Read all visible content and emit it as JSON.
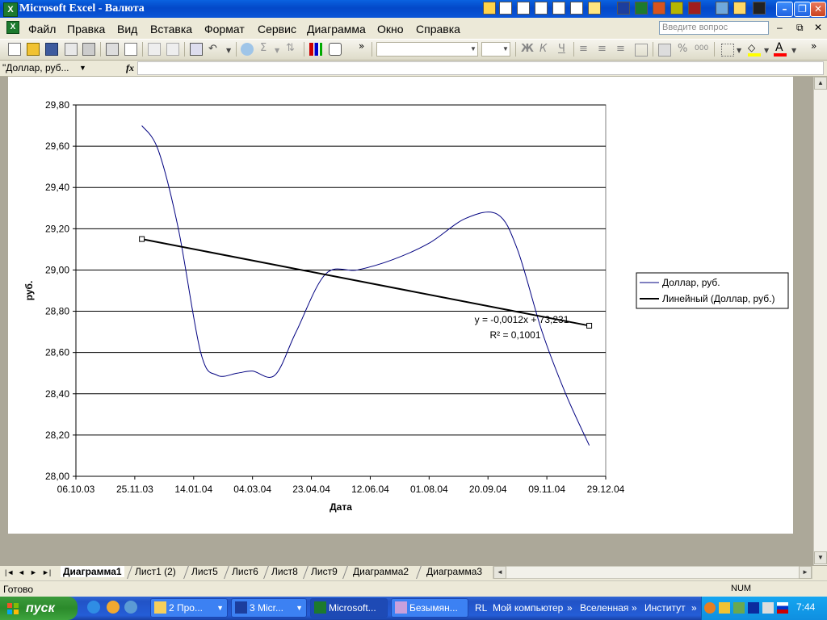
{
  "window": {
    "title": "Microsoft Excel - Валюта",
    "app_icon": "excel-icon",
    "controls": [
      "minimize-icon",
      "restore-icon",
      "close-icon"
    ]
  },
  "menu": {
    "items": [
      "Файл",
      "Правка",
      "Вид",
      "Вставка",
      "Формат",
      "Сервис",
      "Диаграмма",
      "Окно",
      "Справка"
    ],
    "help_search_placeholder": "Введите вопрос",
    "doc_controls": [
      "–",
      "⧉",
      "✕"
    ]
  },
  "toolbar": {
    "overflow": "»",
    "icons": [
      "new-icon",
      "open-icon",
      "save-icon",
      "permission-icon",
      "print-icon",
      "print-preview-icon",
      "copy-icon",
      "format-painter-icon",
      "chart-wizard-icon",
      "undo-icon",
      "hyperlink-icon",
      "autosum-icon",
      "sort-icon",
      "chart-icon",
      "help-icon",
      "bold-icon",
      "italic-icon",
      "underline-icon",
      "align-left-icon",
      "align-center-icon",
      "align-right-icon",
      "merge-icon",
      "currency-icon",
      "percent-icon",
      "thousands-icon",
      "borders-icon",
      "fill-color-icon",
      "font-color-icon"
    ],
    "format_glyphs": {
      "bold": "Ж",
      "italic": "К",
      "underline": "Ч",
      "percent": "%",
      "thousands": "000"
    },
    "font_color": "#ff0000",
    "fill_color": "#ffff00"
  },
  "formula_bar": {
    "name_box": "\"Доллар, руб...",
    "fx": "fx",
    "value": ""
  },
  "chart_data": {
    "type": "line",
    "title": "",
    "xlabel": "Дата",
    "ylabel": "руб.",
    "x_ticks": [
      "06.10.03",
      "25.11.03",
      "14.01.04",
      "04.03.04",
      "23.04.04",
      "12.06.04",
      "01.08.04",
      "20.09.04",
      "09.11.04",
      "29.12.04"
    ],
    "y_ticks": [
      "28,00",
      "28,20",
      "28,40",
      "28,60",
      "28,80",
      "29,00",
      "29,20",
      "29,40",
      "29,60",
      "29,80"
    ],
    "ylim": [
      28.0,
      29.8
    ],
    "xlim": [
      "06.10.03",
      "29.12.04"
    ],
    "grid": "horizontal",
    "legend_position": "right",
    "series": [
      {
        "name": "Доллар, руб.",
        "style": "smooth",
        "color": "#000080",
        "points": [
          {
            "x": "01.12.03",
            "y": 29.7
          },
          {
            "x": "15.12.03",
            "y": 29.58
          },
          {
            "x": "01.01.04",
            "y": 29.2
          },
          {
            "x": "20.01.04",
            "y": 28.6
          },
          {
            "x": "03.02.04",
            "y": 28.49
          },
          {
            "x": "20.02.04",
            "y": 28.5
          },
          {
            "x": "04.03.04",
            "y": 28.51
          },
          {
            "x": "23.03.04",
            "y": 28.49
          },
          {
            "x": "10.04.04",
            "y": 28.7
          },
          {
            "x": "05.05.04",
            "y": 28.98
          },
          {
            "x": "01.06.04",
            "y": 29.0
          },
          {
            "x": "01.07.04",
            "y": 29.05
          },
          {
            "x": "01.08.04",
            "y": 29.13
          },
          {
            "x": "01.09.04",
            "y": 29.25
          },
          {
            "x": "28.09.04",
            "y": 29.27
          },
          {
            "x": "15.10.04",
            "y": 29.1
          },
          {
            "x": "05.11.04",
            "y": 28.7
          },
          {
            "x": "25.11.04",
            "y": 28.4
          },
          {
            "x": "15.12.04",
            "y": 28.15
          }
        ]
      },
      {
        "name": "Линейный (Доллар, руб.)",
        "style": "linear-trendline",
        "color": "#000000",
        "points": [
          {
            "x": "01.12.03",
            "y": 29.15
          },
          {
            "x": "15.12.04",
            "y": 28.73
          }
        ]
      }
    ],
    "annotations": {
      "equation": "y = -0,0012x + 73,231",
      "r2": "R² = 0,1001"
    }
  },
  "sheet_tabs": {
    "nav": [
      "|◄",
      "◄",
      "►",
      "►|"
    ],
    "tabs": [
      "Диаграмма1",
      "Лист1 (2)",
      "Лист5",
      "Лист6",
      "Лист8",
      "Лист9",
      "Диаграмма2",
      "Диаграмма3"
    ],
    "active": "Диаграмма1"
  },
  "status": {
    "text": "Готово",
    "num": "NUM"
  },
  "taskbar": {
    "start_label": "пуск",
    "quick_launch": [
      "ie-icon",
      "media-player-icon",
      "outlook-express-icon"
    ],
    "tasks": [
      {
        "label": "2 Про...",
        "icon": "folder-icon",
        "active": false
      },
      {
        "label": "3 Micr...",
        "icon": "word-icon",
        "active": false
      },
      {
        "label": "Microsoft...",
        "icon": "excel-icon",
        "active": true
      },
      {
        "label": "Безымян...",
        "icon": "paint-icon",
        "active": false
      }
    ],
    "links": [
      "RL",
      "Мой компьютер",
      "»",
      "Вселенная",
      "»",
      "Институт",
      "»"
    ],
    "clock": "7:44"
  }
}
